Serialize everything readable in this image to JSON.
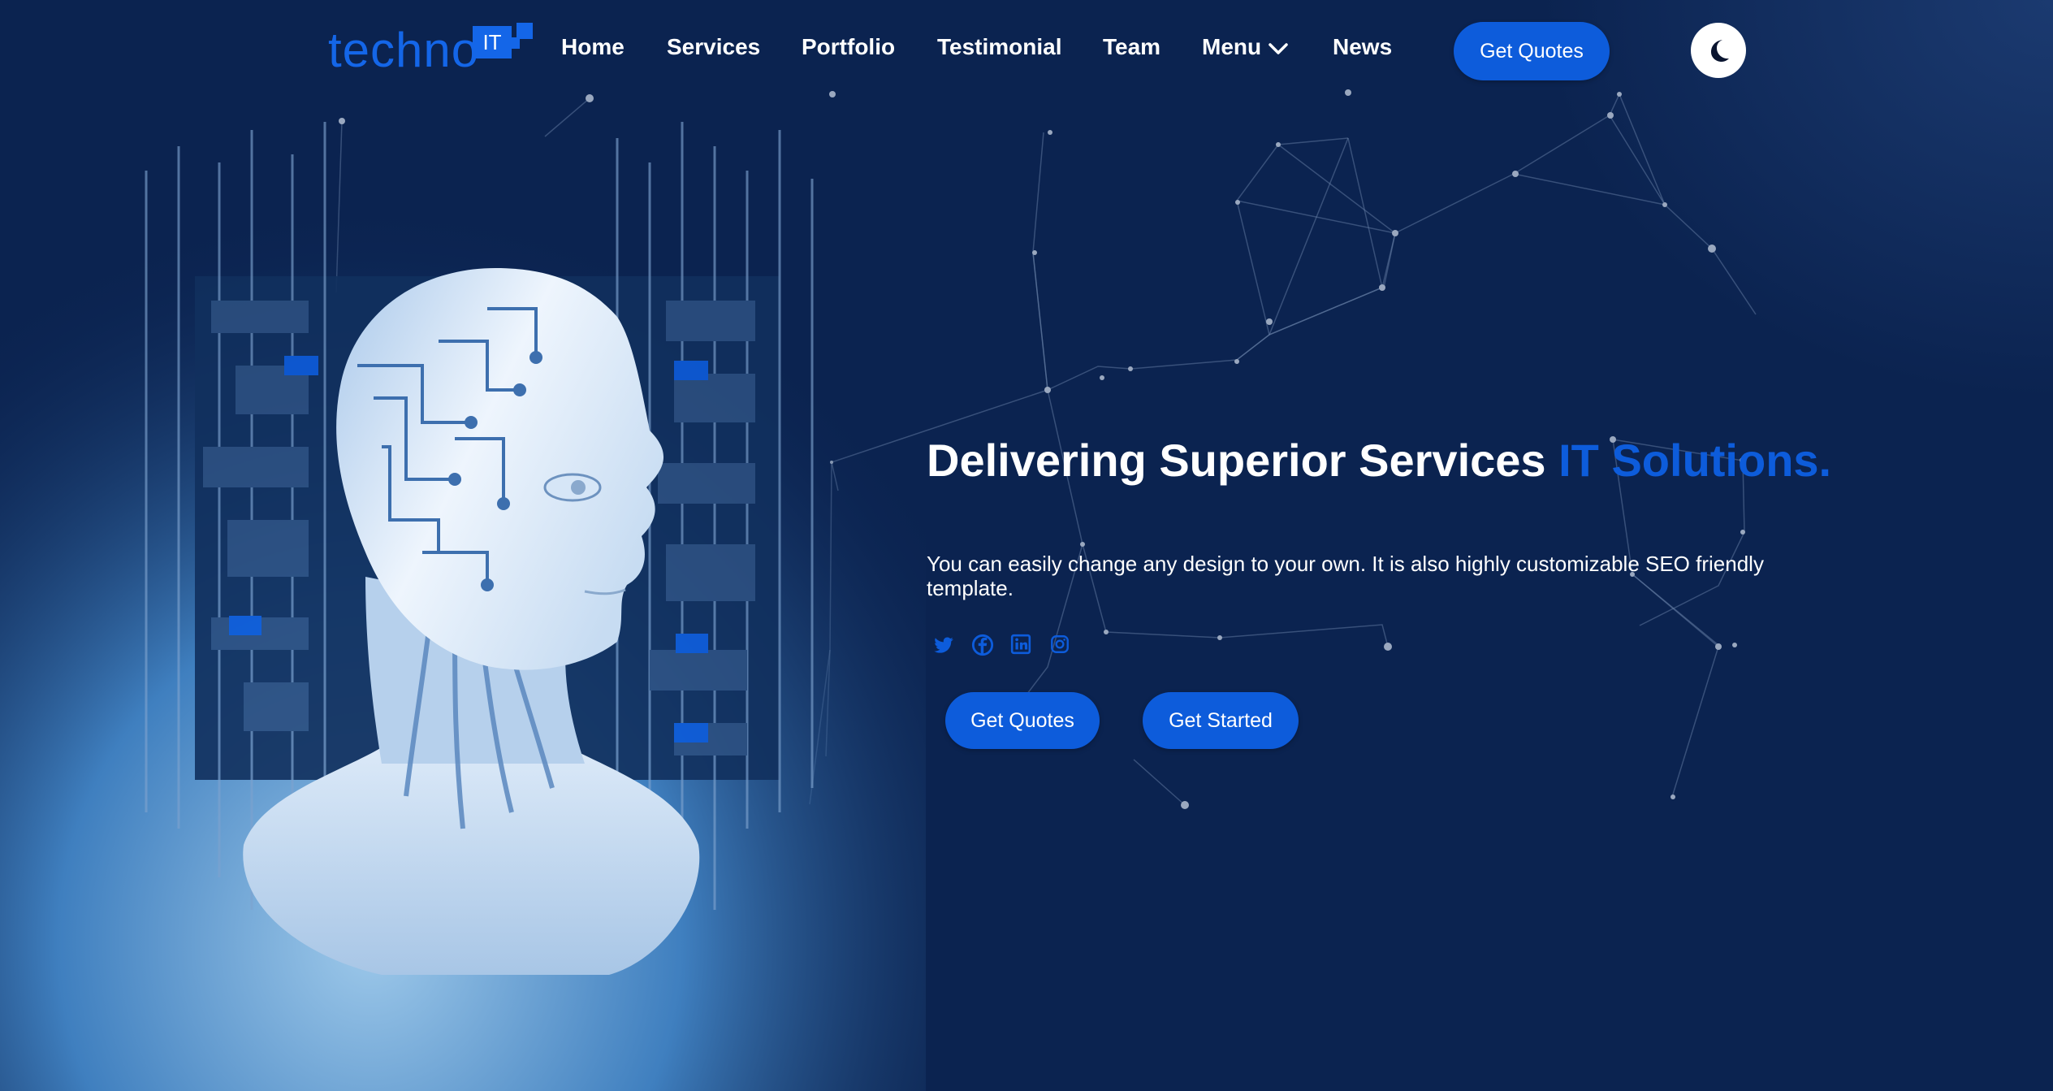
{
  "brand": {
    "name": "techno",
    "badge": "IT"
  },
  "nav": {
    "items": [
      "Home",
      "Services",
      "Portfolio",
      "Testimonial",
      "Team",
      "Menu",
      "News"
    ],
    "quote_button": "Get Quotes"
  },
  "theme_toggle": {
    "icon": "moon-icon"
  },
  "hero": {
    "headline_main": "Delivering Superior Services ",
    "headline_accent": "IT Solutions.",
    "subtext": "You can easily change any design to your own. It is also highly customizable SEO friendly template.",
    "social_icons": [
      "twitter-icon",
      "facebook-icon",
      "linkedin-icon",
      "instagram-icon"
    ],
    "buttons": {
      "primary": "Get Quotes",
      "secondary": "Get Started"
    },
    "image": "robot-head-illustration"
  },
  "colors": {
    "background": "#0b2350",
    "accent": "#0d5cdb",
    "text": "#ffffff"
  }
}
